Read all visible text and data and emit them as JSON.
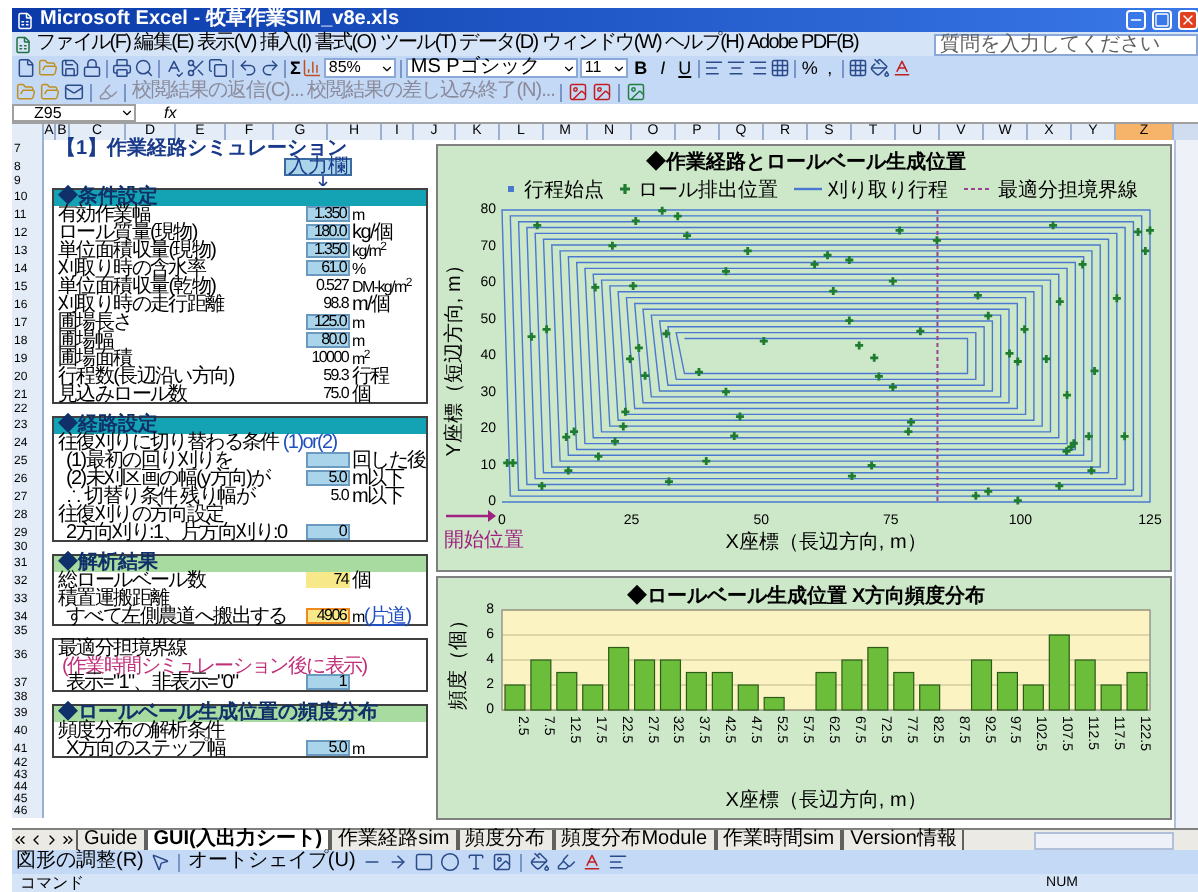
{
  "window": {
    "title": "Microsoft Excel - 牧草作業SIM_v8e.xls"
  },
  "menu": [
    "ファイル(F)",
    "編集(E)",
    "表示(V)",
    "挿入(I)",
    "書式(O)",
    "ツール(T)",
    "データ(D)",
    "ウィンドウ(W)",
    "ヘルプ(H)",
    "Adobe PDF(B)"
  ],
  "help_box": {
    "placeholder": "質問を入力してください"
  },
  "toolbar": {
    "sum": "Σ",
    "zoom": "85%",
    "font": "MS Pゴシック",
    "font_size": "11",
    "format_buttons": [
      "B",
      "I",
      "U"
    ],
    "number_buttons": [
      "%",
      ","
    ]
  },
  "review_toolbar": {
    "items": [
      "校閲結果の返信(C)...",
      "校閲結果の差し込み終了(N)..."
    ]
  },
  "formula_bar": {
    "name_box": "Z95",
    "fx": "fx"
  },
  "columns": [
    {
      "label": "A",
      "selected": false
    },
    {
      "label": "B",
      "selected": false
    },
    {
      "label": "C",
      "selected": false
    },
    {
      "label": "D",
      "selected": false
    },
    {
      "label": "E",
      "selected": false
    },
    {
      "label": "F",
      "selected": false
    },
    {
      "label": "G",
      "selected": false
    },
    {
      "label": "H",
      "selected": false
    },
    {
      "label": "I",
      "selected": false
    },
    {
      "label": "J",
      "selected": false
    },
    {
      "label": "K",
      "selected": false
    },
    {
      "label": "L",
      "selected": false
    },
    {
      "label": "M",
      "selected": false
    },
    {
      "label": "N",
      "selected": false
    },
    {
      "label": "O",
      "selected": false
    },
    {
      "label": "P",
      "selected": false
    },
    {
      "label": "Q",
      "selected": false
    },
    {
      "label": "R",
      "selected": false
    },
    {
      "label": "S",
      "selected": false
    },
    {
      "label": "T",
      "selected": false
    },
    {
      "label": "U",
      "selected": false
    },
    {
      "label": "V",
      "selected": false
    },
    {
      "label": "W",
      "selected": false
    },
    {
      "label": "X",
      "selected": false
    },
    {
      "label": "Y",
      "selected": false
    },
    {
      "label": "Z",
      "selected": true
    }
  ],
  "rows": [
    "7",
    "8",
    "9",
    "10",
    "11",
    "12",
    "13",
    "14",
    "15",
    "16",
    "17",
    "18",
    "19",
    "20",
    "21",
    "22",
    "23",
    "24",
    "25",
    "26",
    "27",
    "28",
    "29",
    "30",
    "31",
    "32",
    "33",
    "34",
    "35",
    "36",
    "37",
    "38",
    "39",
    "40",
    "41",
    "42",
    "43",
    "44",
    "45",
    "46"
  ],
  "sheet": {
    "title": "【1】作業経路シミュレーション",
    "input_label": "入力欄",
    "sections": [
      {
        "header": "◆条件設定",
        "color": "#14a3b4",
        "rows": [
          {
            "kind": "input",
            "label": "有効作業幅",
            "value": "1.350",
            "unit": "m"
          },
          {
            "kind": "input",
            "label": "ロール質量(現物)",
            "value": "180.0",
            "unit": "kg/個"
          },
          {
            "kind": "input",
            "label": "単位面積収量(現物)",
            "value": "1.350",
            "unit": "kg/m$^{2}$"
          },
          {
            "kind": "input",
            "label": "刈取り時の含水率",
            "value": "61.0",
            "unit": "%"
          },
          {
            "kind": "calc",
            "label": "単位面積収量(乾物)",
            "value": "0.527",
            "unit": "DM-kg/m$^{2}$"
          },
          {
            "kind": "calc",
            "label": "刈取り時の走行距離",
            "value": "98.8",
            "unit": "m/個"
          },
          {
            "kind": "input",
            "label": "圃場長さ",
            "value": "125.0",
            "unit": "m"
          },
          {
            "kind": "input",
            "label": "圃場幅",
            "value": "80.0",
            "unit": "m"
          },
          {
            "kind": "calc",
            "label": "圃場面積",
            "value": "10000",
            "unit": "m$^{2}$"
          },
          {
            "kind": "calc",
            "label": "行程数(長辺沿い方向)",
            "value": "59.3",
            "unit": "行程"
          },
          {
            "kind": "calc",
            "label": "見込みロール数",
            "value": "75.0",
            "unit": "個"
          }
        ]
      },
      {
        "header": "◆経路設定",
        "color": "#14a3b4",
        "rows": [
          {
            "kind": "text",
            "label": "往復刈りに切り替わる条件",
            "note": "(1)or(2)",
            "children": [
              {
                "kind": "input",
                "label": "(1)最初の回り刈りを",
                "unit": "回した後"
              },
              {
                "kind": "input",
                "label": "(2)未刈区画の幅(y方向)が",
                "value": "5.0",
                "unit": "m以下"
              },
              {
                "kind": "calc",
                "label": "∴ 切替り条件 残り幅が",
                "value": "5.0",
                "unit": "m以下"
              }
            ]
          },
          {
            "kind": "text",
            "label": "往復刈りの方向設定",
            "children": [
              {
                "kind": "input",
                "label": "2方向刈り:1、片方向刈り:0",
                "value": "0"
              }
            ]
          }
        ]
      },
      {
        "header": "◆解析結果",
        "color": "#a8dba0",
        "rows": [
          {
            "kind": "result",
            "label": "総ロールベール数",
            "value": "74",
            "unit": "個"
          },
          {
            "kind": "text",
            "label": "積置運搬距離",
            "children": [
              {
                "kind": "total",
                "label": "すべて左側農道へ搬出する",
                "value": "4906",
                "unit": "m",
                "unit_note": "(片道)"
              }
            ]
          }
        ]
      },
      {
        "rows": [
          {
            "kind": "text",
            "label": "最適分担境界線",
            "note": "(作業時間シミュレーション後に表示)",
            "children": [
              {
                "kind": "input",
                "label": "表示=\"1\"、非表示=\"0\"",
                "value": "1"
              }
            ]
          }
        ]
      },
      {
        "header": "◆ロールベール生成位置の頻度分布",
        "color": "#a8dba0",
        "rows": [
          {
            "kind": "text",
            "label": "頻度分布の解析条件",
            "children": [
              {
                "kind": "input",
                "label": "X方向のステップ幅",
                "value": "5.0",
                "unit": "m"
              }
            ]
          }
        ]
      }
    ]
  },
  "route_chart": {
    "legend": [
      {
        "kind": "point",
        "text": "行程始点"
      }
    ],
    "chart_data": {
      "type": "scatter",
      "title": "◆作業経路とロールベール生成位置",
      "xlabel": "X座標（長辺方向, m）",
      "ylabel": "Y座標（短辺方向, m）",
      "xlim": [
        0,
        125
      ],
      "ylim": [
        0,
        80
      ],
      "xticks": [
        0,
        25,
        50,
        75,
        100,
        125
      ],
      "yticks": [
        0,
        10,
        20,
        30,
        40,
        50,
        60,
        70,
        80
      ],
      "series": [
        {
          "name": "ロール排出位置",
          "color": "#1e7b30",
          "x": [
            30.9,
            33.9,
            25.8,
            6.8,
            106.3,
            76.7,
            35.7,
            122.7,
            125,
            83.9,
            21.3,
            47.4,
            124.1,
            62.8,
            60.3,
            67,
            112,
            43.2,
            75.4,
            18,
            25.3,
            63.9,
            91.8,
            118.6,
            107.6,
            93.8,
            67,
            5.7,
            8.6,
            80.7,
            100.8,
            31.7,
            50.5,
            68.9,
            97.9,
            71.8,
            24.7,
            26.4,
            99.5,
            105,
            38,
            114.3,
            27.6,
            72.7,
            75.4,
            43.2,
            109,
            23.8,
            45.9,
            78.9,
            23.4,
            13.9,
            78.4,
            12.4,
            44.8,
            21.8,
            110.3,
            109.8,
            113.2,
            120.1,
            108.9,
            18.6,
            39.4,
            1,
            2.1,
            71.3,
            12.8,
            113.7,
            67.5,
            32.2,
            7.7,
            107.5,
            93.8,
            91.4,
            99.5
          ],
          "values": [
            79.8,
            78.3,
            77,
            75.8,
            75.8,
            74.4,
            73,
            74,
            74.4,
            71.7,
            70.2,
            68.8,
            68.8,
            67.6,
            65.1,
            66.3,
            65.1,
            63.2,
            60.5,
            58.8,
            59.2,
            57.8,
            56.6,
            55.8,
            54.9,
            51,
            49.7,
            45.3,
            47.3,
            46.8,
            47.3,
            46.1,
            44.1,
            42.9,
            40.7,
            39.5,
            39.2,
            42.2,
            38.5,
            39.2,
            35.6,
            35.9,
            34.6,
            34.4,
            31.5,
            30.2,
            29.3,
            24.7,
            23.4,
            21.9,
            20.7,
            19.3,
            19.3,
            17.8,
            18.1,
            16.6,
            16.1,
            15.1,
            18,
            18,
            13.9,
            12.5,
            11.2,
            10.7,
            10.7,
            10,
            8.6,
            8.6,
            7.1,
            5.6,
            4.4,
            4.4,
            2.9,
            1.7,
            0.4
          ]
        },
        {
          "name": "刈り取り行程",
          "color": "#4a78d0",
          "type": "line",
          "x": [
            0,
            125,
            125,
            0,
            1.6,
            123.4,
            123.4,
            1.6,
            3.2,
            121.8,
            121.8,
            3.2,
            4.8,
            120.2,
            120.2,
            4.8,
            6.4,
            118.6,
            118.6,
            6.4,
            8,
            117,
            117,
            8,
            9.6,
            115.4,
            115.4,
            9.6,
            11.2,
            113.8,
            113.8,
            11.2,
            12.8,
            112.2,
            112.2,
            12.8,
            14.4,
            110.6,
            110.6,
            14.4,
            16,
            109,
            109,
            16,
            17.6,
            107.4,
            107.4,
            17.6,
            19.2,
            105.8,
            105.8,
            19.2,
            20.8,
            104.2,
            104.2,
            20.8,
            22.4,
            102.6,
            102.6,
            22.4,
            24,
            101,
            101,
            24,
            25.6,
            99.4,
            99.4,
            25.6,
            27.2,
            97.8,
            97.8,
            27.2,
            28.8,
            96.2,
            96.2,
            28.8,
            30.4,
            94.6,
            94.6,
            30.4,
            32,
            93,
            93,
            32,
            33.6,
            91.4,
            91.4,
            33.6,
            35.2,
            89.8,
            89.8,
            35.2
          ],
          "values": [
            0,
            0,
            80,
            80,
            1.6,
            1.6,
            78.4,
            78.4,
            3.2,
            3.2,
            76.8,
            76.8,
            4.8,
            4.8,
            75.2,
            75.2,
            6.4,
            6.4,
            73.6,
            73.6,
            8,
            8,
            72,
            72,
            9.6,
            9.6,
            70.4,
            70.4,
            11.2,
            11.2,
            68.8,
            68.8,
            12.8,
            12.8,
            67.2,
            67.2,
            14.4,
            14.4,
            65.6,
            65.6,
            16,
            16,
            64,
            64,
            17.6,
            17.6,
            62.4,
            62.4,
            19.2,
            19.2,
            60.8,
            60.8,
            20.8,
            20.8,
            59.2,
            59.2,
            22.4,
            22.4,
            57.6,
            57.6,
            24,
            24,
            56,
            56,
            25.6,
            25.6,
            54.4,
            54.4,
            27.2,
            27.2,
            52.8,
            52.8,
            28.8,
            28.8,
            51.2,
            51.2,
            30.4,
            30.4,
            49.6,
            49.6,
            32,
            32,
            48,
            48,
            33.6,
            33.6,
            46.4,
            46.4,
            35.2,
            35.2,
            44.8,
            44.8
          ]
        }
      ],
      "ref_lines": [
        {
          "axis": "x",
          "value": 84,
          "label": "最適分担境界線"
        }
      ],
      "legend": "top",
      "annotations": [
        "開始位置"
      ]
    }
  },
  "histogram": {
    "chart_data": {
      "type": "bar",
      "grid": true,
      "title": "◆ロールベール生成位置 X方向頻度分布",
      "xlabel": "X座標（長辺方向, m）",
      "ylabel": "頻度（個）",
      "ylim": [
        0,
        8
      ],
      "yticks": [
        0,
        2,
        4,
        6,
        8
      ],
      "categories": [
        "2.5",
        "7.5",
        "12.5",
        "17.5",
        "22.5",
        "27.5",
        "32.5",
        "37.5",
        "42.5",
        "47.5",
        "52.5",
        "57.5",
        "62.5",
        "67.5",
        "72.5",
        "77.5",
        "82.5",
        "87.5",
        "92.5",
        "97.5",
        "102.5",
        "107.5",
        "112.5",
        "117.5",
        "122.5"
      ],
      "values": [
        2,
        4,
        3,
        2,
        5,
        4,
        4,
        3,
        3,
        2,
        1,
        0,
        3,
        4,
        5,
        3,
        2,
        0,
        4,
        3,
        2,
        6,
        4,
        2,
        3
      ]
    }
  },
  "sheet_tabs": [
    {
      "label": "Guide",
      "selected": false
    },
    {
      "label": "GUI(入出力シート)",
      "selected": true
    },
    {
      "label": "作業経路sim",
      "selected": false
    },
    {
      "label": "頻度分布",
      "selected": false
    },
    {
      "label": "頻度分布Module",
      "selected": false
    },
    {
      "label": "作業時間sim",
      "selected": false
    },
    {
      "label": "Version情報",
      "selected": false
    }
  ],
  "drawing_toolbar": {
    "items": [
      "図形の調整(R)",
      "オートシェイプ(U)"
    ]
  },
  "status_bar": {
    "mode": "コマンド",
    "num": "NUM"
  }
}
